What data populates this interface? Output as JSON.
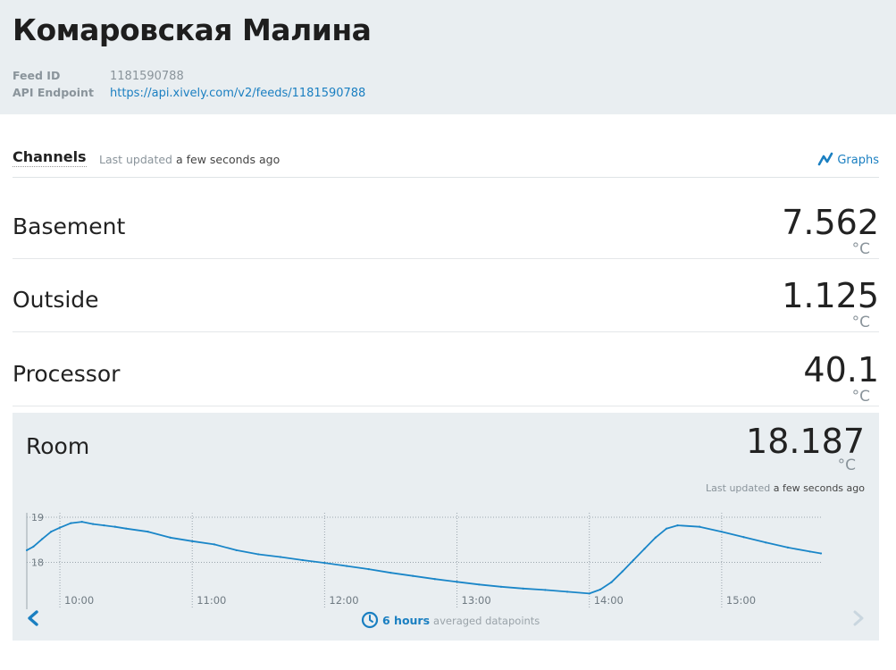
{
  "feed": {
    "title": "Комаровская Малина",
    "id_label": "Feed ID",
    "id_value": "1181590788",
    "api_label": "API Endpoint",
    "api_value": "https://api.xively.com/v2/feeds/1181590788"
  },
  "channels_bar": {
    "title": "Channels",
    "last_updated_prefix": "Last updated",
    "last_updated_value": "a few seconds ago",
    "graphs_label": "Graphs"
  },
  "channels": [
    {
      "name": "Basement",
      "value": "7.562",
      "unit": "°C"
    },
    {
      "name": "Outside",
      "value": "1.125",
      "unit": "°C"
    },
    {
      "name": "Processor",
      "value": "40.1",
      "unit": "°C"
    },
    {
      "name": "Room",
      "value": "18.187",
      "unit": "°C"
    }
  ],
  "room_panel": {
    "last_updated_prefix": "Last updated",
    "last_updated_value": "a few seconds ago",
    "range_label": "6 hours",
    "range_sub": "averaged datapoints"
  },
  "chart_data": {
    "type": "line",
    "y_ticks": [
      "19",
      "18"
    ],
    "x_ticks": [
      "10:00",
      "11:00",
      "12:00",
      "13:00",
      "14:00",
      "15:00"
    ],
    "ylim": [
      17.1,
      19.1
    ],
    "x_range": [
      "09:45",
      "15:45"
    ],
    "series": [
      {
        "color": "#1a86c8",
        "x": [
          "09:45",
          "09:48",
          "09:52",
          "09:56",
          "10:00",
          "10:05",
          "10:10",
          "10:15",
          "10:20",
          "10:25",
          "10:30",
          "10:40",
          "10:50",
          "11:00",
          "11:10",
          "11:20",
          "11:30",
          "11:40",
          "11:50",
          "12:00",
          "12:10",
          "12:20",
          "12:30",
          "12:40",
          "12:50",
          "13:00",
          "13:10",
          "13:20",
          "13:30",
          "13:40",
          "13:50",
          "14:00",
          "14:05",
          "14:10",
          "14:15",
          "14:20",
          "14:25",
          "14:30",
          "14:35",
          "14:40",
          "14:50",
          "15:00",
          "15:10",
          "15:20",
          "15:30",
          "15:40",
          "15:45"
        ],
        "y": [
          18.27,
          18.35,
          18.52,
          18.68,
          18.77,
          18.87,
          18.9,
          18.85,
          18.82,
          18.79,
          18.75,
          18.68,
          18.55,
          18.47,
          18.4,
          18.27,
          18.18,
          18.12,
          18.05,
          17.99,
          17.92,
          17.85,
          17.77,
          17.7,
          17.63,
          17.57,
          17.51,
          17.46,
          17.42,
          17.39,
          17.35,
          17.31,
          17.4,
          17.56,
          17.8,
          18.05,
          18.3,
          18.55,
          18.75,
          18.82,
          18.79,
          18.68,
          18.56,
          18.44,
          18.33,
          18.24,
          18.2
        ]
      }
    ]
  }
}
